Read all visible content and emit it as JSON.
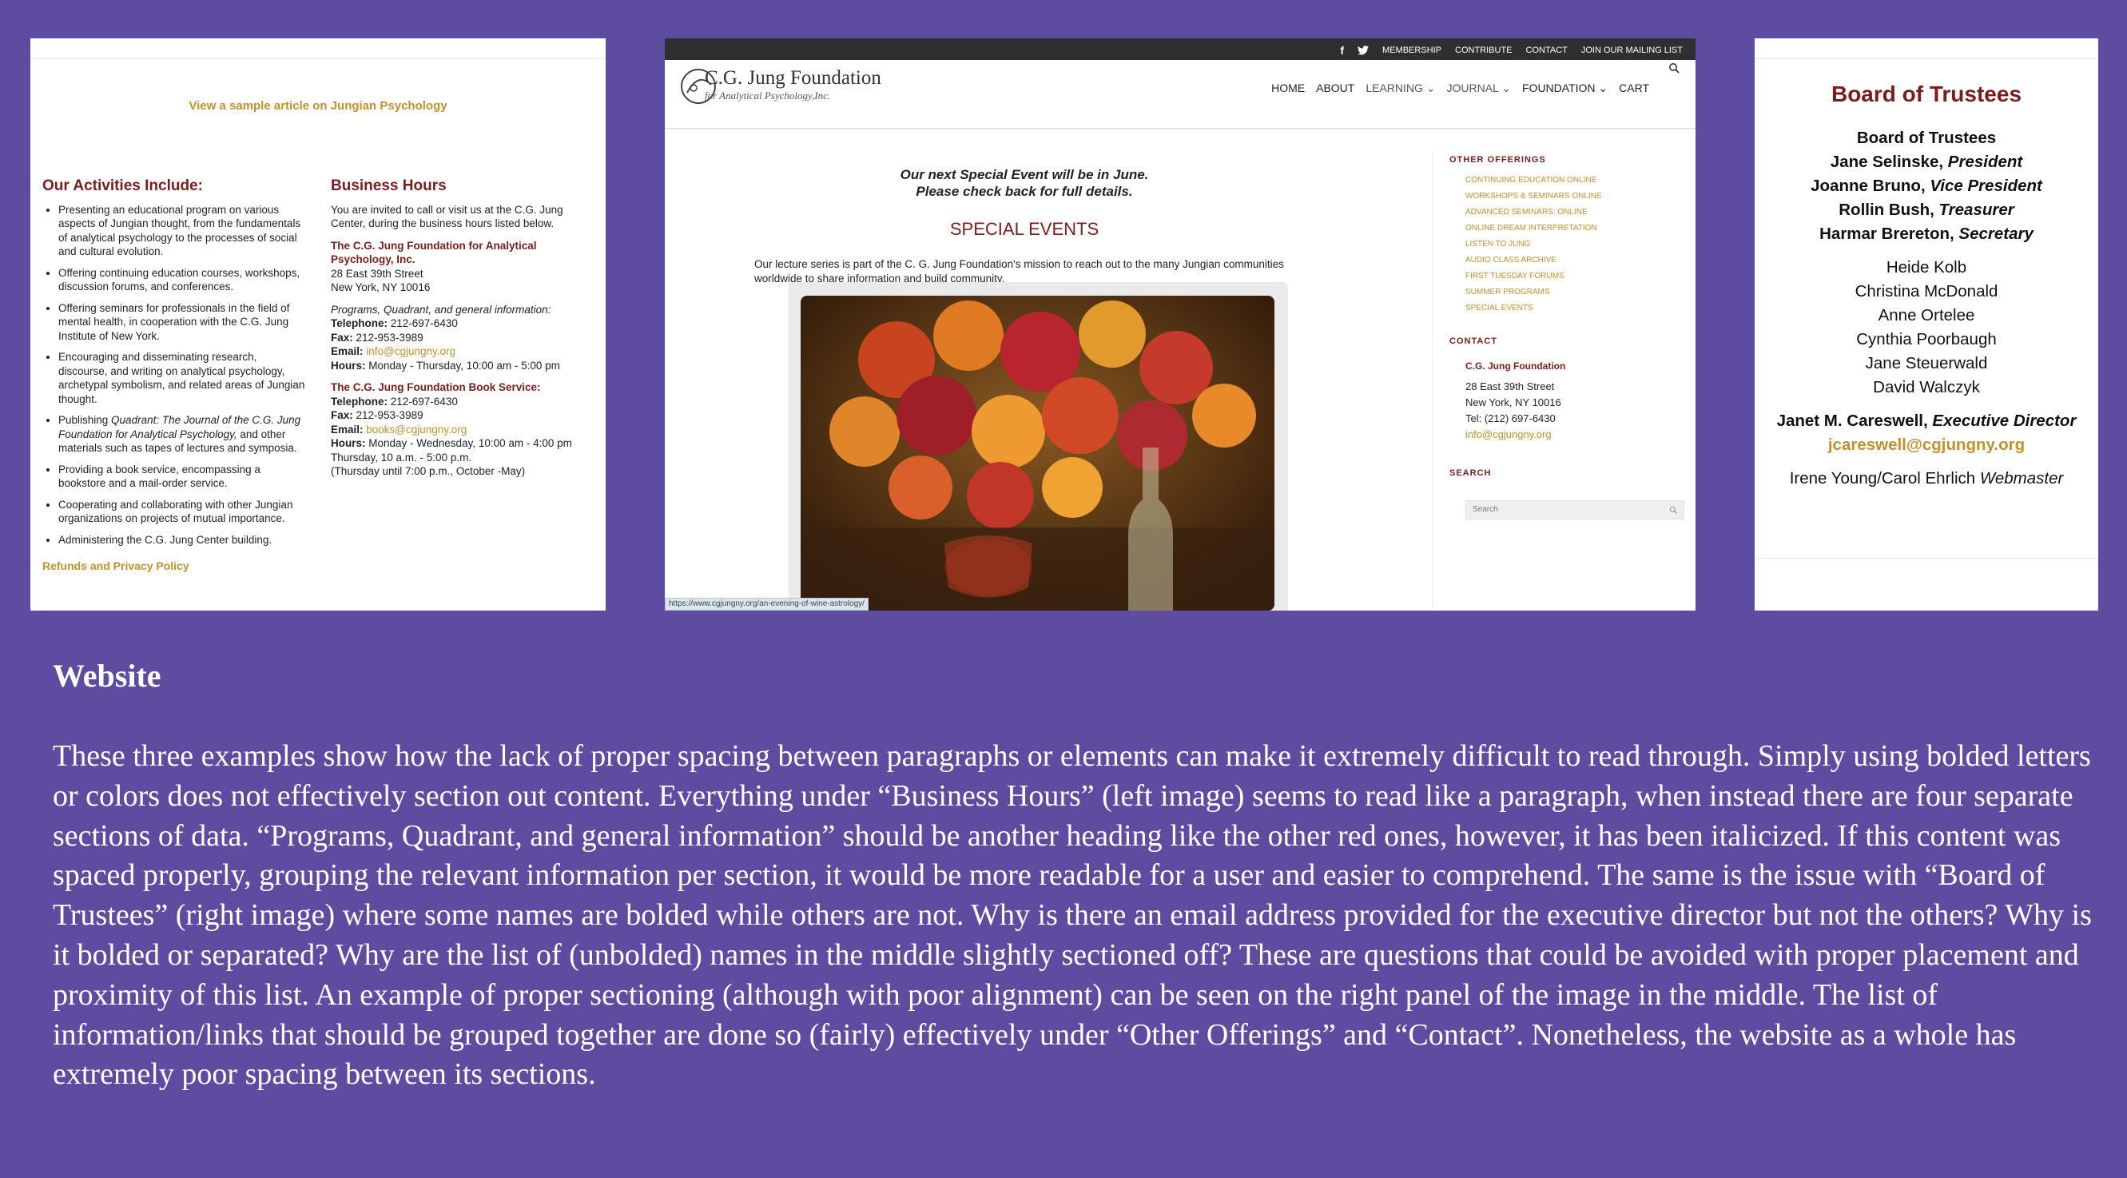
{
  "left_panel": {
    "sample_link": "View a sample article on Jungian Psychology",
    "activities_heading": "Our Activities Include:",
    "activities": [
      "Presenting an educational program on various aspects of Jungian thought, from the fundamentals of analytical psychology to the processes of social and cultural evolution.",
      "Offering continuing education courses, workshops, discussion forums, and conferences.",
      "Offering seminars for professionals in the field of mental health, in cooperation with the C.G. Jung Institute of New York.",
      "Encouraging and disseminating research, discourse, and writing on analytical psychology, archetypal symbolism, and related areas of Jungian thought.",
      "Providing a book service, encompassing a bookstore and a mail-order service.",
      "Cooperating and collaborating with other Jungian organizations on projects of mutual importance.",
      "Administering the C.G. Jung Center building."
    ],
    "publishing_pre": "Publishing ",
    "publishing_it": "Quadrant: The Journal of the C.G. Jung Foundation for Analytical Psychology,",
    "publishing_post": " and other materials such as tapes of lectures and symposia.",
    "refunds": "Refunds and Privacy Policy",
    "hours_heading": "Business Hours",
    "hours_intro": "You are invited to call or visit us at the C.G. Jung Center, during the business hours listed below.",
    "org_name": "The C.G. Jung Foundation for Analytical Psychology, Inc.",
    "address1": "28 East 39th Street",
    "address2": "New York, NY 10016",
    "programs_label": "Programs, Quadrant, and general information:",
    "tel_label": "Telephone:",
    "tel1": " 212-697-6430",
    "fax_label": "Fax:",
    "fax1": " 212-953-3989",
    "email_label": "Email:",
    "email1": "info@cgjungny.org",
    "hours_label": "Hours:",
    "hours1": " Monday - Thursday, 10:00 am - 5:00 pm",
    "book_heading": "The C.G. Jung Foundation Book Service:",
    "tel2": " 212-697-6430",
    "fax2": " 212-953-3989",
    "email2": "books@cgjungny.org",
    "hours2": " Monday - Wednesday, 10:00 am - 4:00 pm",
    "hours2b": "Thursday, 10 a.m. - 5:00 p.m.",
    "hours2c": "(Thursday until 7:00 p.m., October -May)"
  },
  "middle_panel": {
    "topbar": [
      "MEMBERSHIP",
      "CONTRIBUTE",
      "CONTACT",
      "JOIN OUR MAILING LIST"
    ],
    "logo_title": "C.G. Jung Foundation",
    "logo_sub": "for Analytical Psychology,Inc.",
    "nav": [
      "HOME",
      "ABOUT",
      "LEARNING ⌄",
      "JOURNAL ⌄",
      "FOUNDATION ⌄",
      "CART"
    ],
    "event_line1": "Our next Special Event will be in June.",
    "event_line2": "Please check back for full details.",
    "special_events": "SPECIAL EVENTS",
    "lecture_text": "Our lecture series is part of the C. G. Jung Foundation's mission to reach out to the many Jungian communities worldwide to share information and build community.",
    "status_url": "https://www.cgjungny.org/an-evening-of-wine-astrology/",
    "other_offerings_heading": "OTHER OFFERINGS",
    "other_offerings": [
      "CONTINUING EDUCATION ONLINE",
      "WORKSHOPS & SEMINARS ONLINE",
      "ADVANCED SEMINARS: ONLINE",
      "ONLINE DREAM INTERPRETATION",
      "LISTEN TO JUNG",
      "AUDIO CLASS ARCHIVE",
      "FIRST TUESDAY FORUMS",
      "SUMMER PROGRAMS",
      "SPECIAL EVENTS"
    ],
    "contact_heading": "CONTACT",
    "contact_name": "C.G. Jung Foundation",
    "contact_addr1": "28 East 39th Street",
    "contact_addr2": "New York, NY 10016",
    "contact_tel": "Tel: (212) 697-6430",
    "contact_email": "info@cgjungny.org",
    "search_heading": "SEARCH",
    "search_placeholder": "Search"
  },
  "right_panel": {
    "title": "Board of Trustees",
    "board_label": "Board of Trustees",
    "p1_name": "Jane Selinske, ",
    "p1_role": "President",
    "p2_name": "Joanne Bruno, ",
    "p2_role": "Vice President",
    "p3_name": "Rollin Bush, ",
    "p3_role": "Treasurer",
    "p4_name": "Harmar Brereton, ",
    "p4_role": "Secretary",
    "members": [
      "Heide Kolb",
      "Christina McDonald",
      "Anne Ortelee",
      "Cynthia Poorbaugh",
      "Jane Steuerwald",
      "David Walczyk"
    ],
    "exec_name": "Janet M. Careswell, ",
    "exec_role": "Executive Director",
    "exec_email": "jcareswell@cgjungny.org",
    "webmaster_names": "Irene Young/Carol Ehrlich ",
    "webmaster_role": "Webmaster"
  },
  "caption": {
    "heading": "Website",
    "body": "These three examples show how the lack of proper spacing between paragraphs or elements can make it extremely difficult to read through. Simply using bolded letters or colors does not effectively section out content. Everything under “Business Hours” (left image) seems to read like a paragraph, when instead there are four separate sections of data. “Programs, Quadrant, and general information” should be another heading like the other red ones, however, it has been italicized. If this content was spaced properly, grouping the relevant information per section, it would be more readable for a user and easier to comprehend. The same is the issue with “Board of Trustees” (right image) where some names are bolded while others are not. Why is there an email address provided for the executive director but not the others? Why is it bolded or separated? Why are the list of (unbolded) names in the middle slightly sectioned off? These are questions that could be avoided with proper placement and proximity of this list. An example of proper sectioning (although with poor alignment) can be seen on the right panel of the image in the middle. The list of information/links that should be grouped together are done so (fairly) effectively under “Other Offerings” and “Contact”. Nonetheless, the website as a whole has extremely poor spacing between its sections."
  }
}
